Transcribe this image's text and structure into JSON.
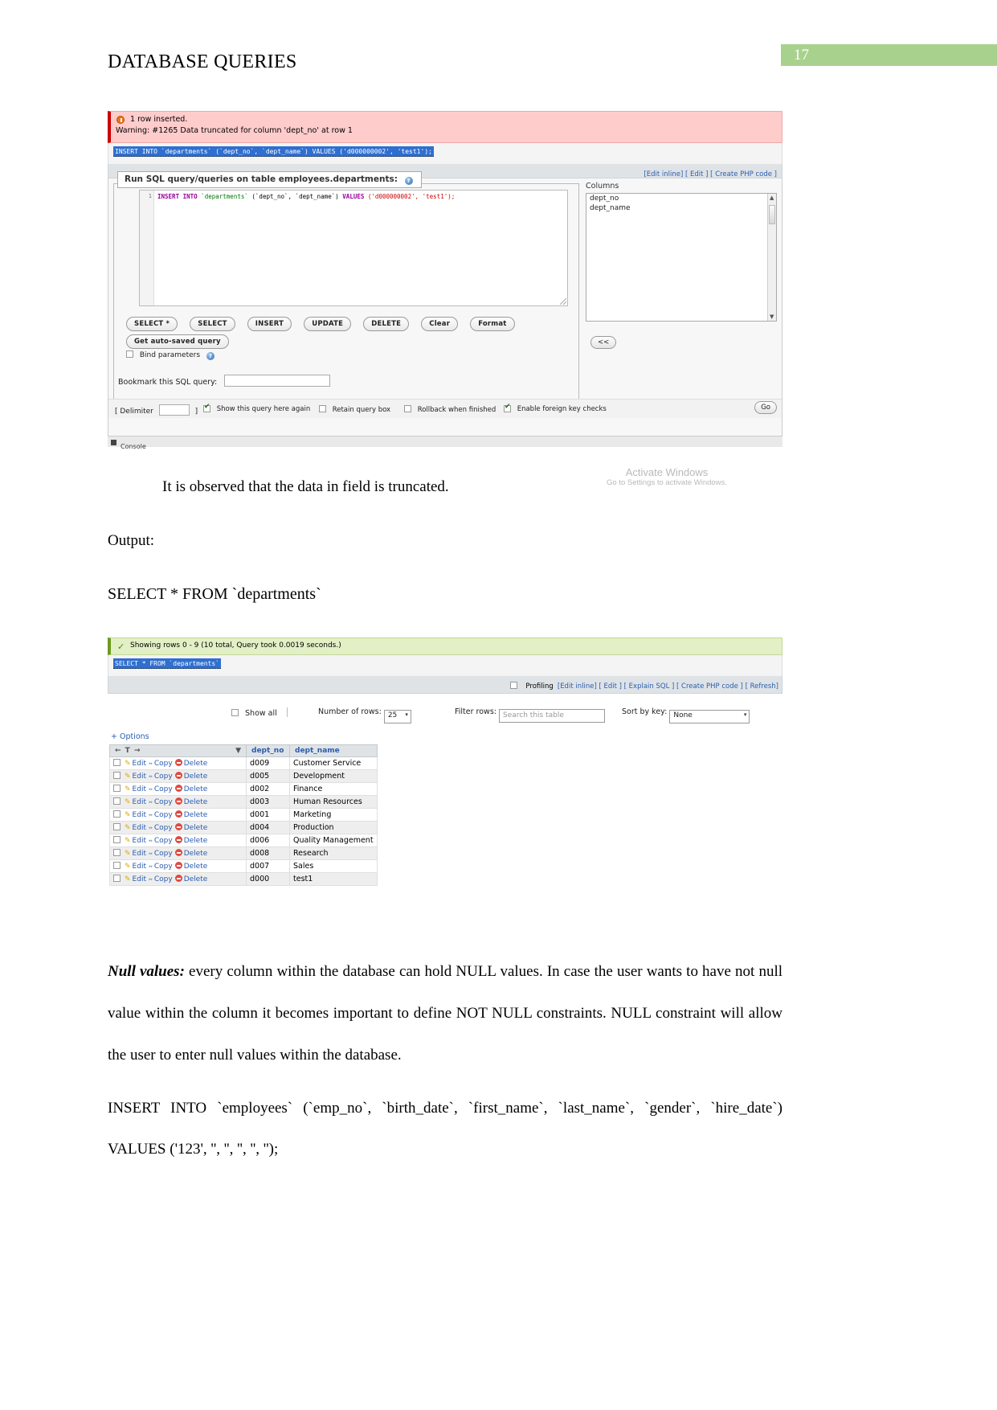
{
  "header": {
    "title": "DATABASE QUERIES",
    "page_number": "17",
    "badge_color": "#a9d18e"
  },
  "screenshot_sql": {
    "warning": {
      "line1": "1 row inserted.",
      "line2": "Warning: #1265 Data truncated for column 'dept_no' at row 1",
      "icon": "warning-circle-icon",
      "background": "#ffcccc"
    },
    "executed_sql": "INSERT INTO `departments` (`dept_no`, `dept_name`) VALUES ('d000000002', 'test1');",
    "action_links": "[Edit inline] [ Edit ] [ Create PHP code ]",
    "fieldset_legend": "Run SQL query/queries on table employees.departments:",
    "editor": {
      "line_number": "1",
      "code_kw1": "INSERT INTO",
      "code_table": "`departments`",
      "code_cols": "(`dept_no`, `dept_name`)",
      "code_kw2": "VALUES",
      "code_vals": "('d000000002', 'test1');"
    },
    "buttons": [
      "SELECT *",
      "SELECT",
      "INSERT",
      "UPDATE",
      "DELETE",
      "Clear",
      "Format"
    ],
    "autosave_button": "Get auto-saved query",
    "bind_parameters_label": "Bind parameters",
    "bookmark_label": "Bookmark this SQL query:",
    "bookmark_value": "",
    "delimiter_label": "Delimiter",
    "delimiter_value": ";",
    "options": [
      {
        "label": "Show this query here again",
        "checked": true
      },
      {
        "label": "Retain query box",
        "checked": false
      },
      {
        "label": "Rollback when finished",
        "checked": false
      },
      {
        "label": "Enable foreign key checks",
        "checked": true
      }
    ],
    "go_button": "Go",
    "columns_panel": {
      "label": "Columns",
      "items": [
        "dept_no",
        "dept_name"
      ],
      "back_button": "<<"
    },
    "watermark": {
      "line1": "Activate Windows",
      "line2": "Go to Settings to activate Windows."
    },
    "console_label": "Console"
  },
  "body": {
    "observed": "It is observed that the data in field is truncated.",
    "output_label": "Output:",
    "select_statement": "SELECT * FROM `departments`"
  },
  "screenshot_results": {
    "status": "Showing rows 0 - 9 (10 total, Query took 0.0019 seconds.)",
    "status_icon": "check-icon",
    "executed_sql": "SELECT * FROM `departments`",
    "profiling_label": "Profiling",
    "links": "[Edit inline] [ Edit ] [ Explain SQL ] [ Create PHP code ] [ Refresh]",
    "controls": {
      "show_all_label": "Show all",
      "number_of_rows_label": "Number of rows:",
      "number_of_rows_value": "25",
      "filter_rows_label": "Filter rows:",
      "filter_rows_placeholder": "Search this table",
      "sort_by_key_label": "Sort by key:",
      "sort_by_key_value": "None"
    },
    "options_link": "+ Options",
    "table": {
      "action_header": "← T →",
      "columns": [
        "dept_no",
        "dept_name"
      ],
      "row_actions": [
        "Edit",
        "Copy",
        "Delete"
      ],
      "rows": [
        {
          "dept_no": "d009",
          "dept_name": "Customer Service"
        },
        {
          "dept_no": "d005",
          "dept_name": "Development"
        },
        {
          "dept_no": "d002",
          "dept_name": "Finance"
        },
        {
          "dept_no": "d003",
          "dept_name": "Human Resources"
        },
        {
          "dept_no": "d001",
          "dept_name": "Marketing"
        },
        {
          "dept_no": "d004",
          "dept_name": "Production"
        },
        {
          "dept_no": "d006",
          "dept_name": "Quality Management"
        },
        {
          "dept_no": "d008",
          "dept_name": "Research"
        },
        {
          "dept_no": "d007",
          "dept_name": "Sales"
        },
        {
          "dept_no": "d000",
          "dept_name": "test1"
        }
      ]
    }
  },
  "closing": {
    "null_values_heading": "Null values:",
    "null_values_text": " every column within the database can hold NULL values. In case the user wants to have not null value within the column it becomes important to define NOT NULL constraints. NULL constraint will allow the user to enter null values within the database.",
    "insert_statement": "INSERT INTO `employees` (`emp_no`, `birth_date`, `first_name`, `last_name`, `gender`, `hire_date`) VALUES ('123', '', '', '', '', '');"
  }
}
